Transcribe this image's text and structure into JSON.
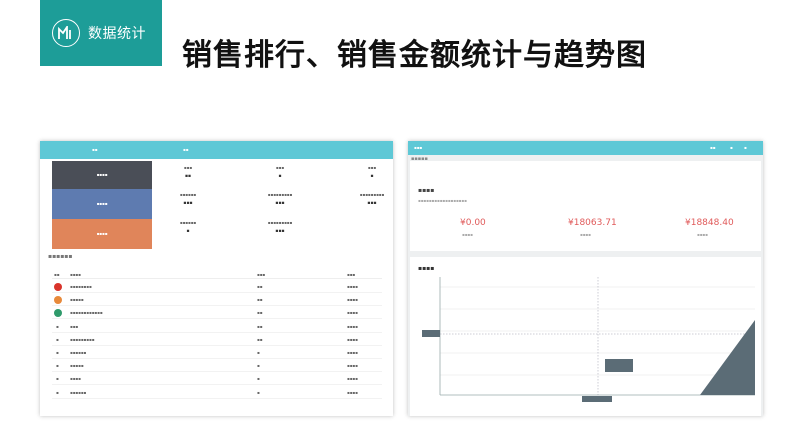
{
  "header": {
    "badge_text": "数据统计",
    "title": "销售排行、销售金额统计与趋势图"
  },
  "colors": {
    "badge": "#1d9d98",
    "bar": "#5ec8d6",
    "side_dark": "#4a4e57",
    "side_blue": "#5e7bb0",
    "side_orange": "#e0855a",
    "money_red": "#e05a5a"
  }
}
